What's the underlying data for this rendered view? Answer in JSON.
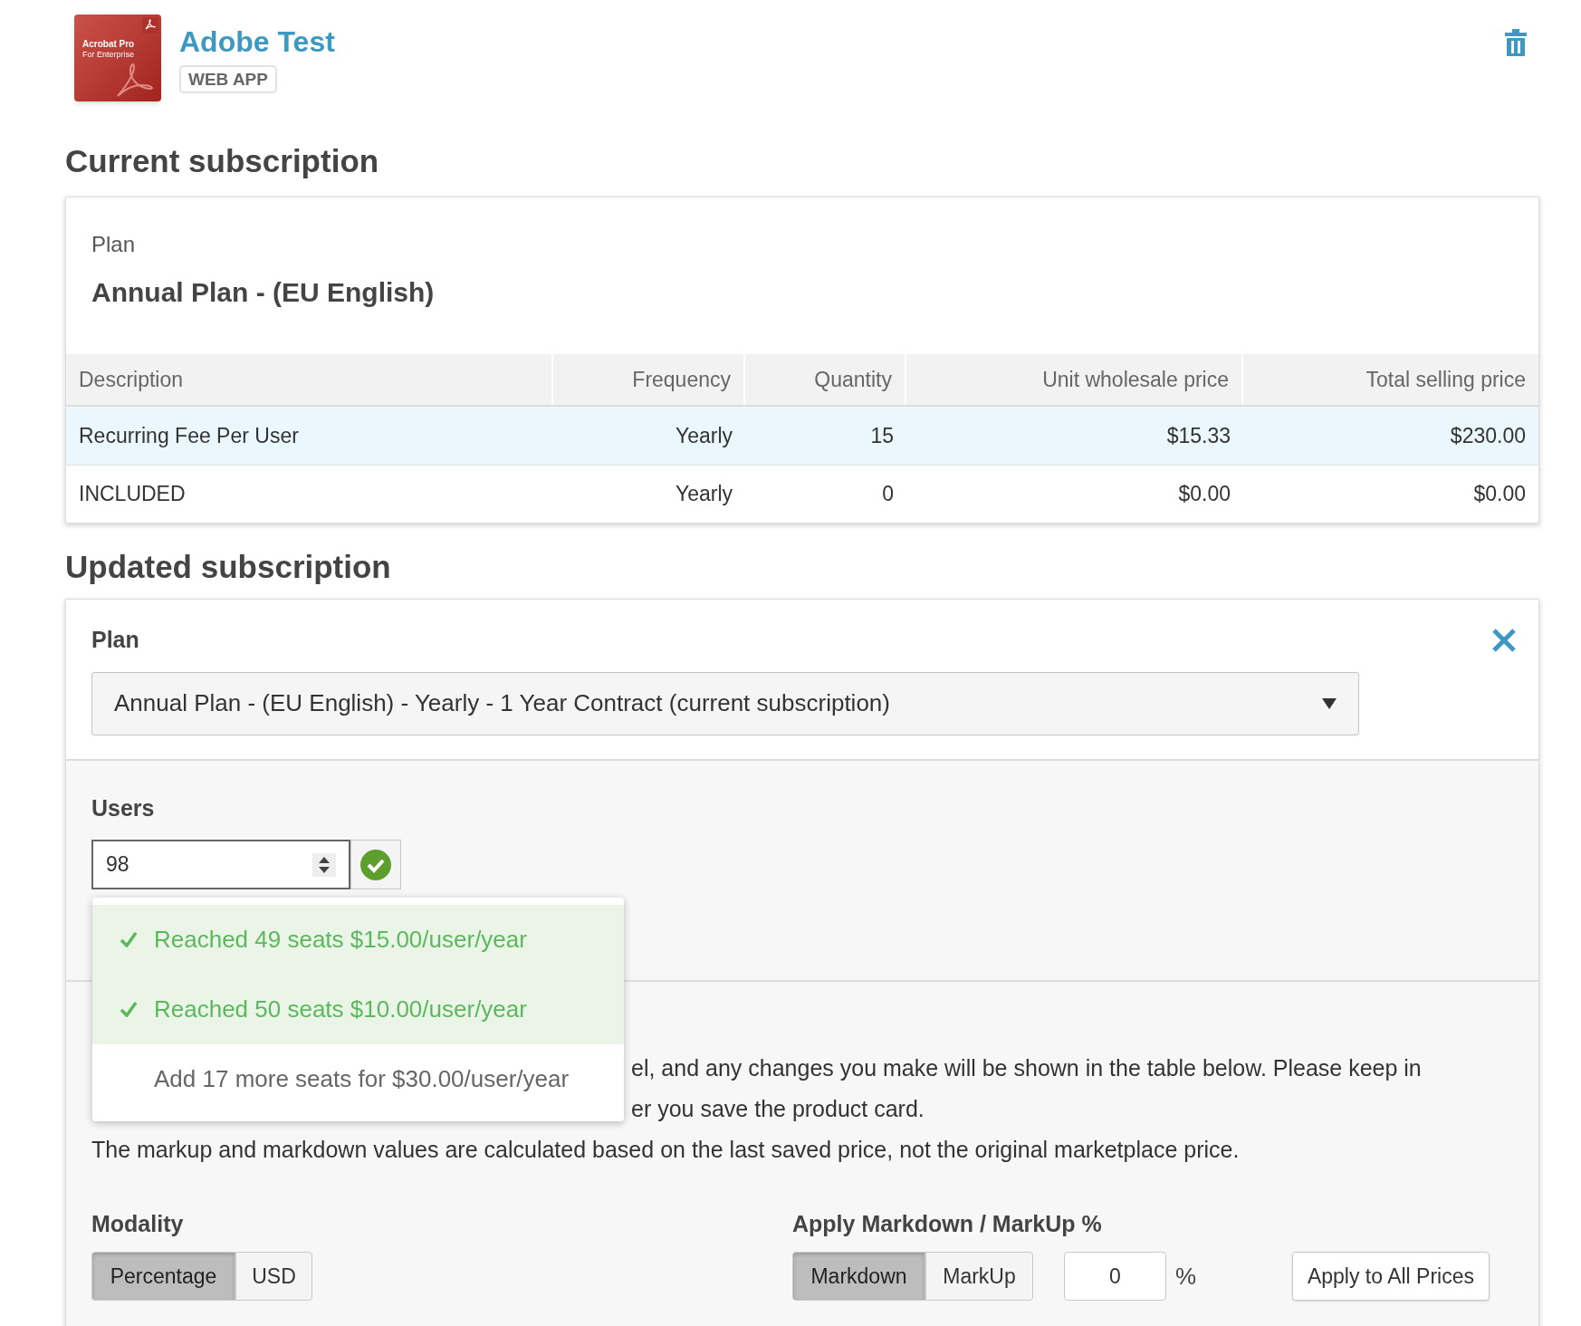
{
  "app": {
    "name": "Adobe Test",
    "badge": "WEB APP",
    "logo": {
      "title": "Acrobat Pro",
      "subtitle": "For Enterprise"
    }
  },
  "current_subscription": {
    "heading": "Current subscription",
    "plan_label": "Plan",
    "plan_name": "Annual Plan - (EU English)",
    "table": {
      "columns": [
        "Description",
        "Frequency",
        "Quantity",
        "Unit wholesale price",
        "Total selling price"
      ],
      "rows": [
        {
          "cells": [
            "Recurring Fee Per User",
            "Yearly",
            "15",
            "$15.33",
            "$230.00"
          ],
          "highlighted": true
        },
        {
          "cells": [
            "INCLUDED",
            "Yearly",
            "0",
            "$0.00",
            "$0.00"
          ],
          "highlighted": false
        }
      ]
    }
  },
  "updated_subscription": {
    "heading": "Updated subscription",
    "plan_label": "Plan",
    "plan_select": {
      "value": "Annual Plan - (EU English) - Yearly - 1 Year Contract (current subscription)"
    },
    "users": {
      "label": "Users",
      "value": "98",
      "valid": true,
      "tiers": [
        {
          "text": "Reached 49 seats $15.00/user/year",
          "reached": true
        },
        {
          "text": "Reached 50 seats $10.00/user/year",
          "reached": true
        },
        {
          "text": "Add 17 more seats for $30.00/user/year",
          "reached": false
        }
      ]
    },
    "note_lines": [
      "el, and any changes you make will be shown in the table below. Please keep in",
      "er you save the product card.",
      "The markup and markdown values are calculated based on the last saved price, not the original marketplace price."
    ],
    "modality": {
      "label": "Modality",
      "options": [
        {
          "label": "Percentage",
          "selected": true
        },
        {
          "label": "USD",
          "selected": false
        }
      ]
    },
    "adjust": {
      "label": "Apply Markdown / MarkUp %",
      "options": [
        {
          "label": "Markdown",
          "selected": true
        },
        {
          "label": "MarkUp",
          "selected": false
        }
      ],
      "value": "0",
      "unit": "%",
      "apply_button": "Apply to All Prices"
    }
  }
}
